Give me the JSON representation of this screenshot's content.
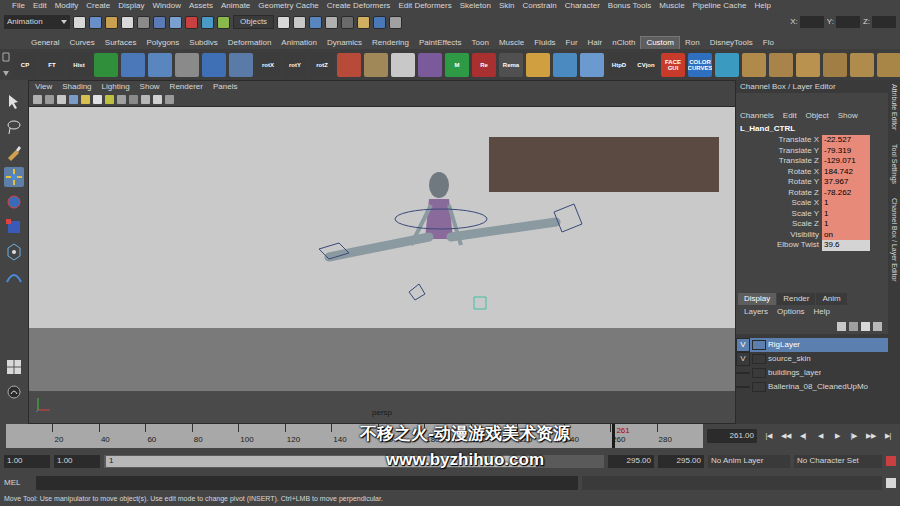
{
  "menu_bar": [
    "File",
    "Edit",
    "Modify",
    "Create",
    "Display",
    "Window",
    "Assets",
    "Animate",
    "Geometry Cache",
    "Create Deformers",
    "Edit Deformers",
    "Skeleton",
    "Skin",
    "Constrain",
    "Character",
    "Bonus Tools",
    "Muscle",
    "Pipeline Cache",
    "Help"
  ],
  "status_line": {
    "mode": "Animation",
    "selection_mode": "Objects",
    "coordinate_labels": [
      "X:",
      "Y:",
      "Z:"
    ]
  },
  "shelf_tabs": [
    {
      "label": "General",
      "selected": false
    },
    {
      "label": "Curves",
      "selected": false
    },
    {
      "label": "Surfaces",
      "selected": false
    },
    {
      "label": "Polygons",
      "selected": false
    },
    {
      "label": "Subdivs",
      "selected": false
    },
    {
      "label": "Deformation",
      "selected": false
    },
    {
      "label": "Animation",
      "selected": false
    },
    {
      "label": "Dynamics",
      "selected": false
    },
    {
      "label": "Rendering",
      "selected": false
    },
    {
      "label": "PaintEffects",
      "selected": false
    },
    {
      "label": "Toon",
      "selected": false
    },
    {
      "label": "Muscle",
      "selected": false
    },
    {
      "label": "Fluids",
      "selected": false
    },
    {
      "label": "Fur",
      "selected": false
    },
    {
      "label": "Hair",
      "selected": false
    },
    {
      "label": "nCloth",
      "selected": false
    },
    {
      "label": "Custom",
      "selected": true
    },
    {
      "label": "Ron",
      "selected": false
    },
    {
      "label": "DisneyTools",
      "selected": false
    },
    {
      "label": "Flo",
      "selected": false
    }
  ],
  "shelf_buttons": [
    {
      "label": "CP",
      "color": "#3c3c3c"
    },
    {
      "label": "FT",
      "color": "#3c3c3c"
    },
    {
      "label": "Hist",
      "color": "#3c3c3c"
    },
    {
      "label": "",
      "color": "#2f8f3a"
    },
    {
      "label": "",
      "color": "#4a78b8"
    },
    {
      "label": "",
      "color": "#5a86c0"
    },
    {
      "label": "",
      "color": "#8a8a8a"
    },
    {
      "label": "",
      "color": "#3f6fb5"
    },
    {
      "label": "",
      "color": "#5a7aa8"
    },
    {
      "label": "rotX",
      "color": "#3c3c3c"
    },
    {
      "label": "rotY",
      "color": "#3c3c3c"
    },
    {
      "label": "rotZ",
      "color": "#3c3c3c"
    },
    {
      "label": "",
      "color": "#b84a3a"
    },
    {
      "label": "",
      "color": "#a08858"
    },
    {
      "label": "",
      "color": "#c8c8c8"
    },
    {
      "label": "",
      "color": "#7a5a9a"
    },
    {
      "label": "M",
      "color": "#2f9a45"
    },
    {
      "label": "Re",
      "color": "#a83030"
    },
    {
      "label": "Rema",
      "color": "#505050"
    },
    {
      "label": "",
      "color": "#d0a040"
    },
    {
      "label": "",
      "color": "#4a8ac0"
    },
    {
      "label": "",
      "color": "#6a9ad0"
    },
    {
      "label": "HtpD",
      "color": "#3c3c3c"
    },
    {
      "label": "CVjon",
      "color": "#3c3c3c"
    },
    {
      "label": "FACE GUI",
      "color": "#c83a2a"
    },
    {
      "label": "COLOR CURVES",
      "color": "#2f6fc0"
    },
    {
      "label": "",
      "color": "#3a9ac0"
    },
    {
      "label": "",
      "color": "#b08a4a"
    },
    {
      "label": "",
      "color": "#a8844a"
    },
    {
      "label": "",
      "color": "#b8924e"
    },
    {
      "label": "",
      "color": "#a07e44"
    },
    {
      "label": "",
      "color": "#b08c4c"
    },
    {
      "label": "",
      "color": "#a88648"
    },
    {
      "label": "",
      "color": "#b4904c"
    }
  ],
  "viewport": {
    "menu": [
      "View",
      "Shading",
      "Lighting",
      "Show",
      "Renderer",
      "Panels"
    ],
    "camera": "persp"
  },
  "channel_box": {
    "title": "Channel Box / Layer Editor",
    "menu": [
      "Channels",
      "Edit",
      "Object",
      "Show"
    ],
    "object": "L_Hand_CTRL",
    "attributes": [
      {
        "name": "Translate X",
        "value": "-22.527",
        "keyed": true
      },
      {
        "name": "Translate Y",
        "value": "-79.319",
        "keyed": true
      },
      {
        "name": "Translate Z",
        "value": "-129.071",
        "keyed": true
      },
      {
        "name": "Rotate X",
        "value": "184.742",
        "keyed": true
      },
      {
        "name": "Rotate Y",
        "value": "37.967",
        "keyed": true
      },
      {
        "name": "Rotate Z",
        "value": "-78.262",
        "keyed": true
      },
      {
        "name": "Scale X",
        "value": "1",
        "keyed": true
      },
      {
        "name": "Scale Y",
        "value": "1",
        "keyed": true
      },
      {
        "name": "Scale Z",
        "value": "1",
        "keyed": true
      },
      {
        "name": "Visibility",
        "value": "on",
        "keyed": true
      },
      {
        "name": "Elbow Twist",
        "value": "39.6",
        "keyed": false
      }
    ]
  },
  "layer_editor": {
    "tabs": [
      {
        "label": "Display",
        "selected": true
      },
      {
        "label": "Render",
        "selected": false
      },
      {
        "label": "Anim",
        "selected": false
      }
    ],
    "menu": [
      "Layers",
      "Options",
      "Help"
    ],
    "visibility_label": "V",
    "layers": [
      {
        "name": "RigLayer",
        "visible": true,
        "selected": true
      },
      {
        "name": "source_skin",
        "visible": true,
        "selected": false
      },
      {
        "name": "buildings_layer",
        "visible": false,
        "selected": false
      },
      {
        "name": "Ballerina_08_CleanedUpMo",
        "visible": false,
        "selected": false
      }
    ]
  },
  "side_tabs": [
    "Attribute Editor",
    "Tool Settings",
    "Channel Box / Layer Editor"
  ],
  "timeline": {
    "ticks": [
      "20",
      "40",
      "60",
      "80",
      "100",
      "120",
      "140",
      "160",
      "180",
      "200",
      "220",
      "240",
      "260",
      "280"
    ],
    "current_frame": "261",
    "current_field": "261.00",
    "playback_buttons": [
      "|◀",
      "◀◀",
      "◀|",
      "◀",
      "▶",
      "|▶",
      "▶▶",
      "▶|"
    ]
  },
  "range_slider": {
    "start_time": "1.00",
    "playback_start": "1.00",
    "range_start": "1",
    "range_end": "295",
    "playback_end": "295.00",
    "end_time": "295.00",
    "anim_layer": "No Anim Layer",
    "character_set": "No Character Set"
  },
  "command_line": {
    "language": "MEL"
  },
  "help_line": "Move Tool: Use manipulator to move object(s). Use edit mode to change pivot (INSERT). Ctrl+LMB to move perpendicular.",
  "watermark": [
    "不移之火-动漫游戏美术资源",
    "www.byzhihuo.com"
  ]
}
